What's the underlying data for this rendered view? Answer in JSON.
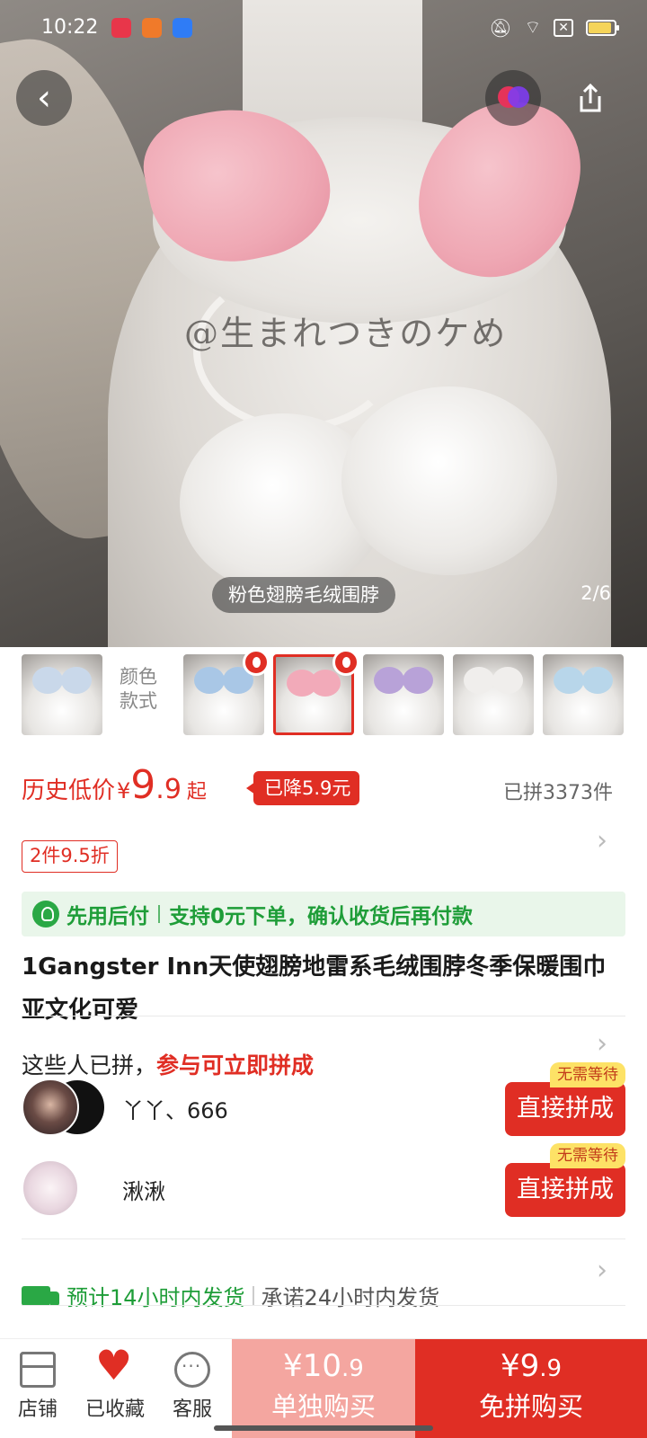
{
  "status_bar": {
    "time": "10:22",
    "app_icons": [
      "red-video-app-icon",
      "orange-book-app-icon",
      "blue-app-icon"
    ],
    "system_icons": [
      "mute-icon",
      "wifi-icon",
      "sim-off-icon",
      "battery-icon"
    ],
    "battery_level": 0.9
  },
  "hero": {
    "watermark": "@生まれつきのケめ",
    "caption": "粉色翅膀毛绒围脖",
    "page_counter": "2/6",
    "current_page": 2,
    "total_pages": 6
  },
  "variants": {
    "label": "颜色\n款式",
    "thumbnails": [
      {
        "wing_color": "#c9d8ea",
        "selected": false,
        "hot": false
      },
      {
        "wing_color": "#a9c7e6",
        "selected": false,
        "hot": true
      },
      {
        "wing_color": "#f2aab9",
        "selected": true,
        "hot": true
      },
      {
        "wing_color": "#b8a2d8",
        "selected": false,
        "hot": false
      },
      {
        "wing_color": "#f0eeec",
        "selected": false,
        "hot": false
      },
      {
        "wing_color": "#b8d6ea",
        "selected": false,
        "hot": false
      }
    ]
  },
  "price": {
    "label": "历史低价",
    "currency": "¥",
    "integer": "9",
    "decimal": ".9",
    "suffix": "起",
    "drop_badge": "已降5.9元",
    "sold": "已拼3373件",
    "discount_tag": "2件9.5折"
  },
  "pay_later": {
    "lead": "先用后付",
    "detail": "支持0元下单，确认收货后再付款"
  },
  "product": {
    "title": "1Gangster Inn天使翅膀地雷系毛绒围脖冬季保暖围巾亚文化可爱"
  },
  "group_buy": {
    "heading": "这些人已拼，",
    "heading_highlight": "参与可立即拼成",
    "rows": [
      {
        "names": "丫丫、666",
        "tag": "无需等待",
        "button": "直接拼成"
      },
      {
        "names": "湫湫",
        "tag": "无需等待",
        "button": "直接拼成"
      }
    ]
  },
  "shipping": {
    "estimate": "预计14小时内发货",
    "promise": "承诺24小时内发货"
  },
  "bottom_bar": {
    "tabs": [
      {
        "label": "店铺",
        "icon": "store-icon"
      },
      {
        "label": "已收藏",
        "icon": "heart-icon"
      },
      {
        "label": "客服",
        "icon": "chat-icon"
      }
    ],
    "buy_alone": {
      "currency": "¥",
      "integer": "10",
      "decimal": ".9",
      "label": "单独购买"
    },
    "buy_group": {
      "currency": "¥",
      "integer": "9",
      "decimal": ".9",
      "label": "免拼购买"
    }
  },
  "colors": {
    "accent_red": "#e02e24",
    "pay_green": "#1e9d38",
    "buy_alone_bg": "#f4a6a0",
    "nowait_yellow": "#fde266"
  }
}
